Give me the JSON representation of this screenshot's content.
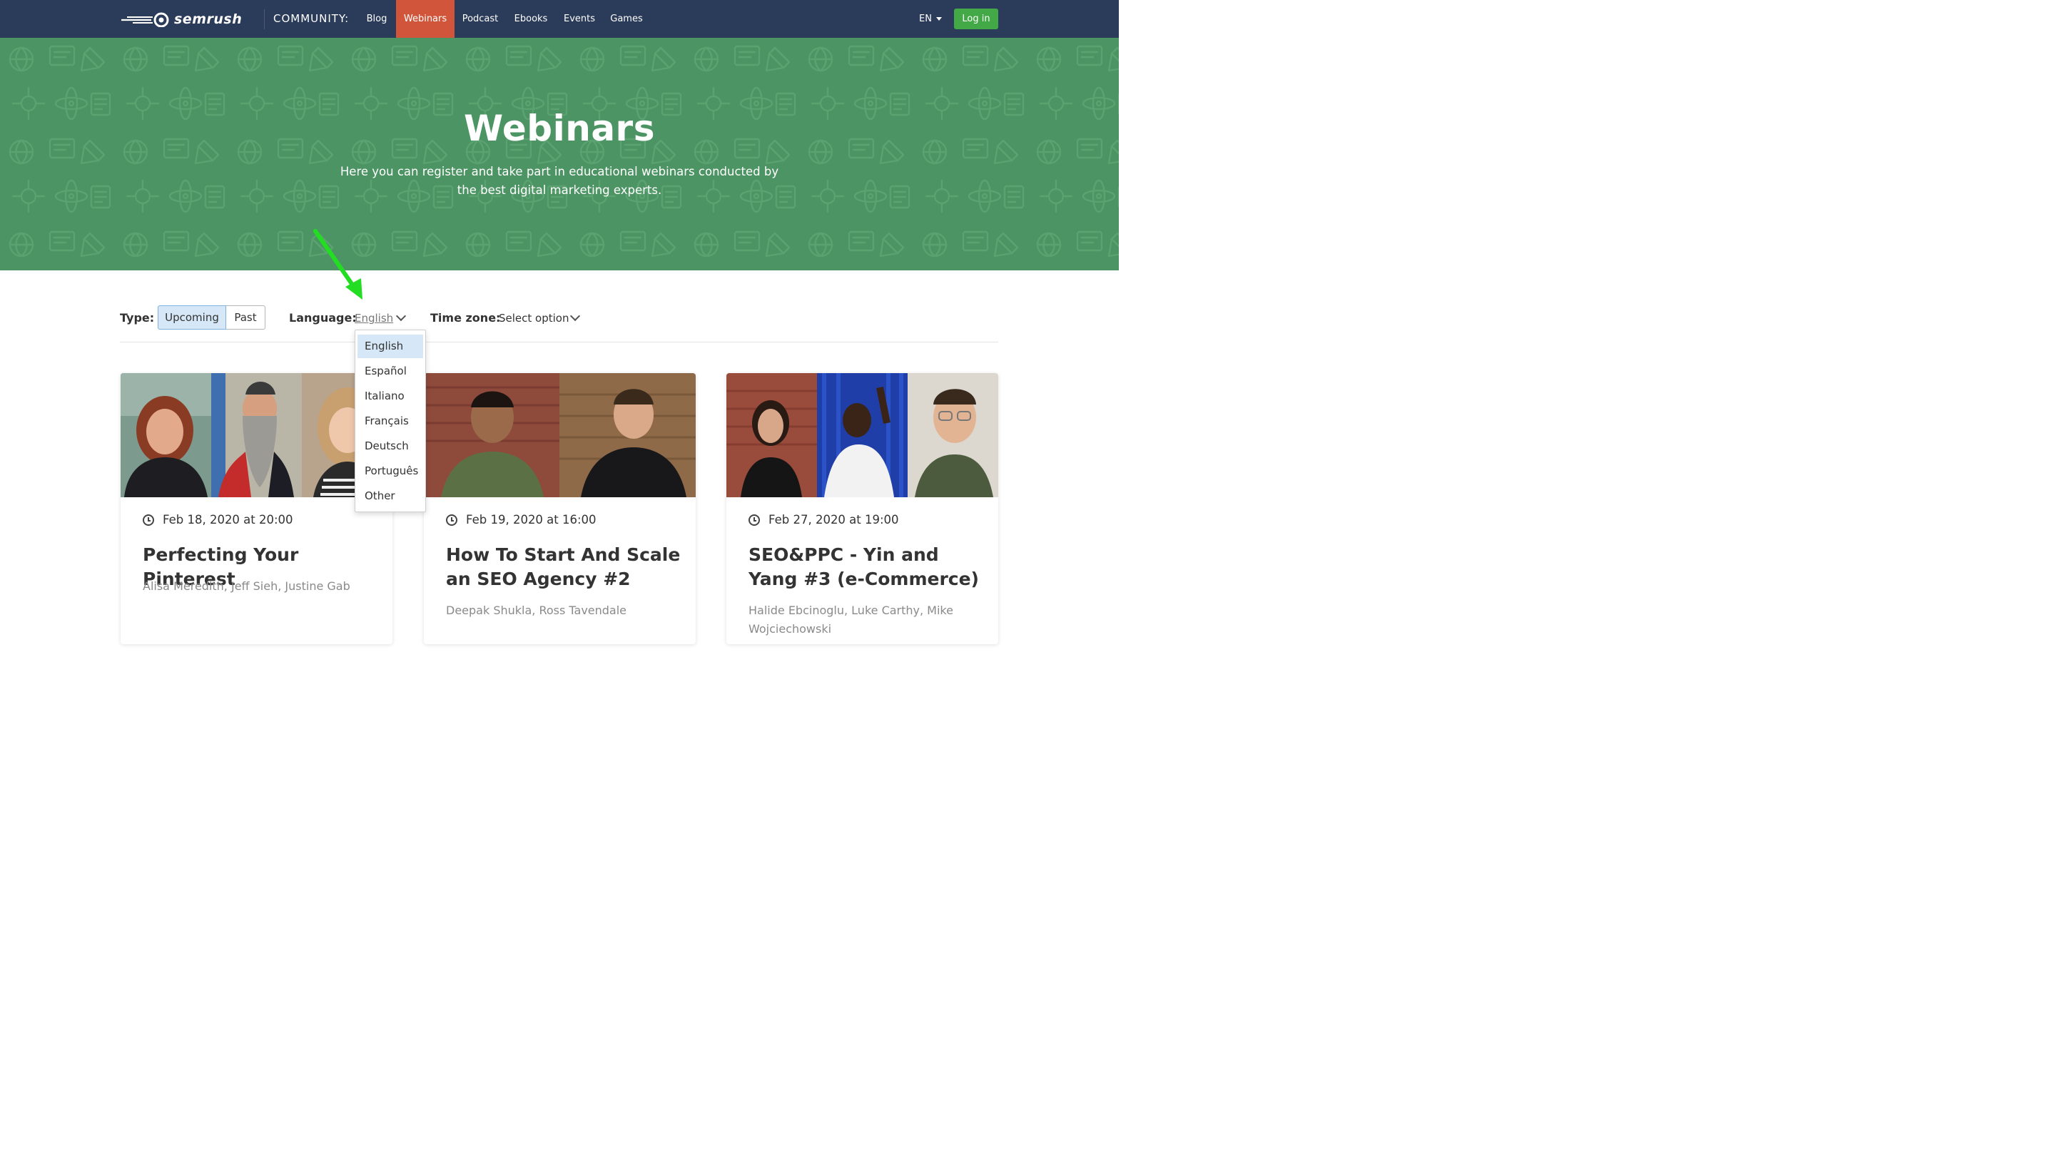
{
  "nav": {
    "logo_text": "semrush",
    "community_label": "COMMUNITY:",
    "links": [
      "Blog",
      "Webinars",
      "Podcast",
      "Ebooks",
      "Events",
      "Games"
    ],
    "active_link": "Webinars",
    "language_switch": "EN",
    "login_label": "Log in"
  },
  "hero": {
    "title": "Webinars",
    "subtitle": "Here you can register and take part in educational webinars conducted by the best digital marketing experts."
  },
  "filters": {
    "type_label": "Type:",
    "type_options": [
      "Upcoming",
      "Past"
    ],
    "type_selected": "Upcoming",
    "language_label": "Language:",
    "language_value": "English",
    "timezone_label": "Time zone:",
    "timezone_value": "Select option"
  },
  "language_dropdown": {
    "options": [
      "English",
      "Español",
      "Italiano",
      "Français",
      "Deutsch",
      "Português",
      "Other"
    ],
    "selected": "English"
  },
  "cards": [
    {
      "date": "Feb 18, 2020 at 20:00",
      "title": "Perfecting Your Pinterest",
      "authors": "Alisa Meredith, Jeff Sieh, Justine Gab"
    },
    {
      "date": "Feb 19, 2020 at 16:00",
      "title": "How To Start And Scale an SEO Agency #2",
      "authors": "Deepak Shukla, Ross Tavendale"
    },
    {
      "date": "Feb 27, 2020 at 19:00",
      "title": "SEO&PPC - Yin and Yang #3 (e-Commerce)",
      "authors": "Halide Ebcinoglu, Luke Carthy, Mike Wojciechowski"
    }
  ],
  "colors": {
    "nav_bg": "#2b3b5a",
    "active_tab": "#d1553a",
    "login_button": "#43a947",
    "hero_bg": "#4c9463",
    "segment_selected": "#d6e8f8",
    "annotation_arrow": "#22dd22"
  },
  "icons": [
    "semrush-logo-icon",
    "caret-down-icon",
    "chevron-down-icon",
    "clock-icon",
    "annotation-arrow-icon"
  ]
}
